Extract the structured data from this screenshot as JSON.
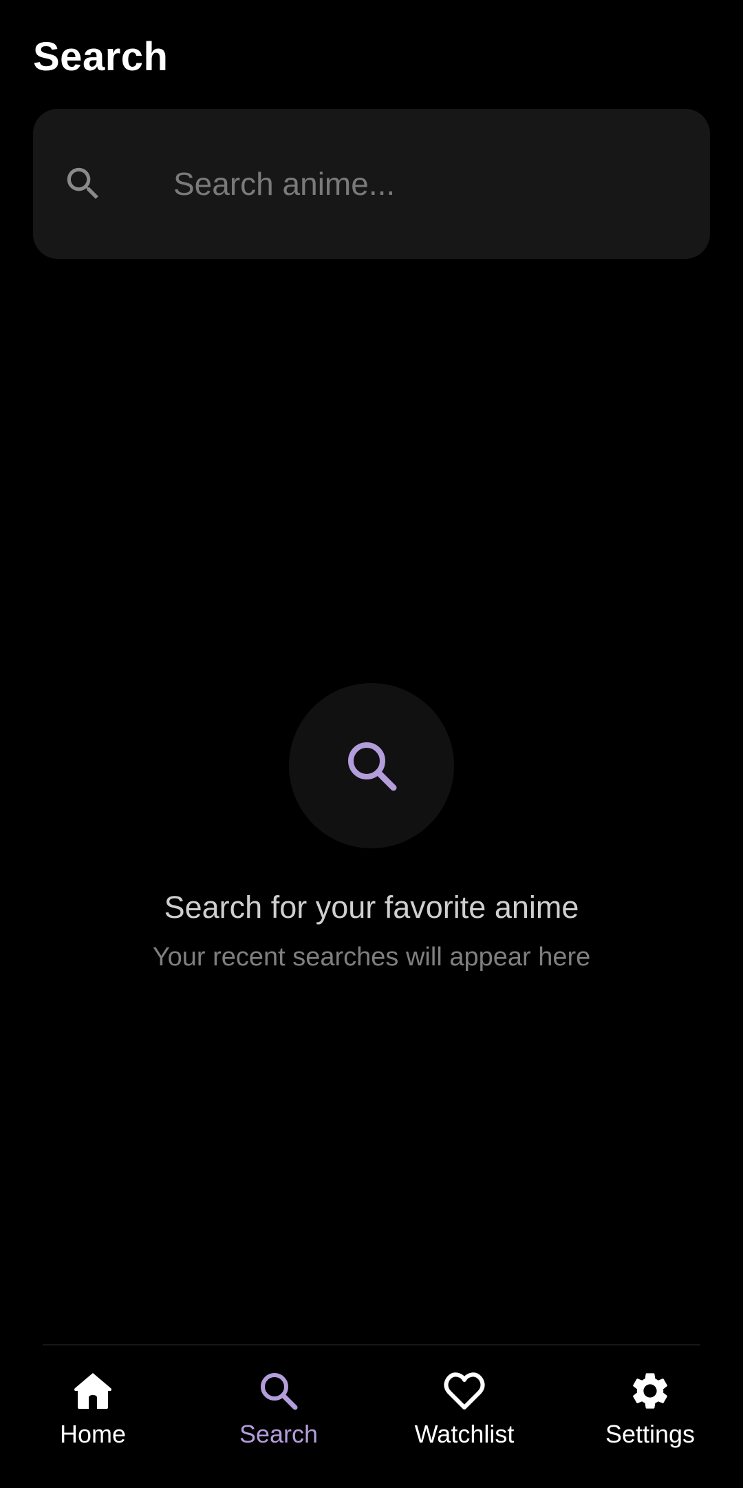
{
  "header": {
    "title": "Search"
  },
  "search": {
    "placeholder": "Search anime...",
    "value": "",
    "icon": "search-icon"
  },
  "empty_state": {
    "icon": "search-icon",
    "title": "Search for your favorite anime",
    "subtitle": "Your recent searches will appear here"
  },
  "bottom_nav": {
    "items": [
      {
        "label": "Home",
        "icon": "home-icon",
        "active": false
      },
      {
        "label": "Search",
        "icon": "search-icon",
        "active": true
      },
      {
        "label": "Watchlist",
        "icon": "heart-icon",
        "active": false
      },
      {
        "label": "Settings",
        "icon": "gear-icon",
        "active": false
      }
    ]
  },
  "colors": {
    "background": "#000000",
    "surface": "#171717",
    "accent": "#b39ddb",
    "muted_text": "#7f7f7f"
  }
}
